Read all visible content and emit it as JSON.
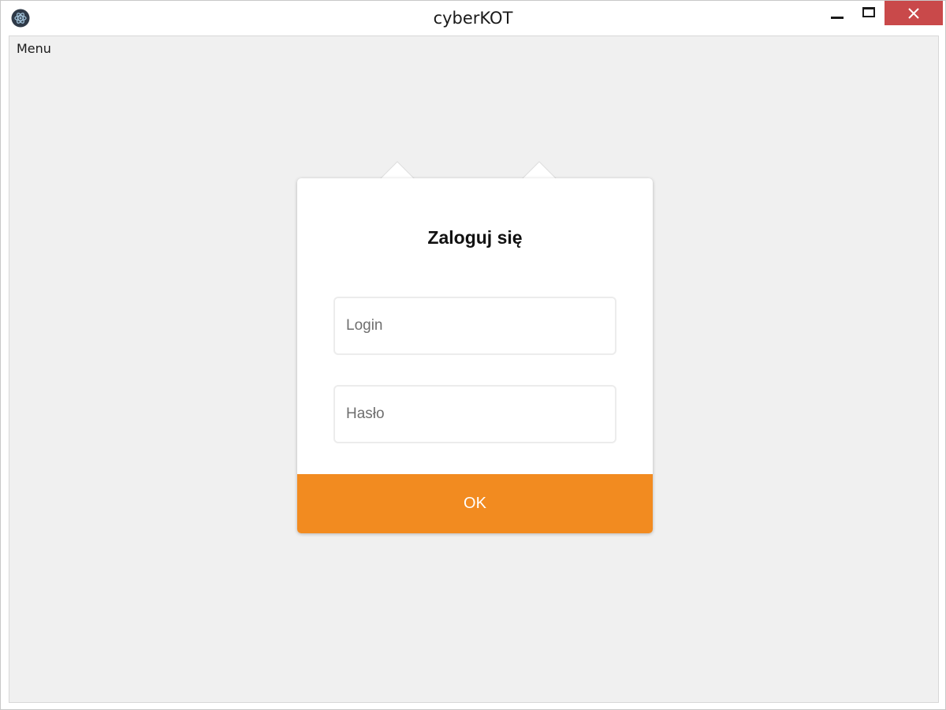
{
  "window": {
    "title": "cyberKOT",
    "close_color": "#c9494a"
  },
  "menubar": {
    "menu_label": "Menu"
  },
  "login": {
    "heading": "Zaloguj się",
    "login_placeholder": "Login",
    "login_value": "",
    "password_placeholder": "Hasło",
    "password_value": "",
    "ok_label": "OK",
    "accent": "#f28b20"
  },
  "icons": {
    "app": "app-logo-icon",
    "minimize": "minimize-icon",
    "maximize": "maximize-icon",
    "close": "close-icon"
  }
}
